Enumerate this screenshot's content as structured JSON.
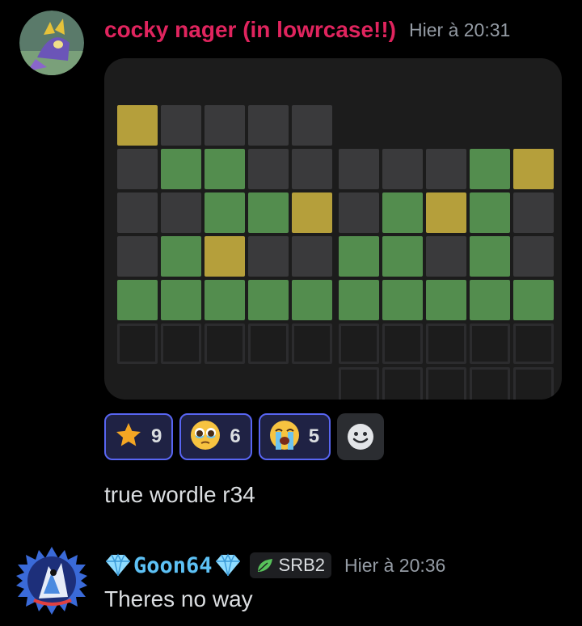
{
  "messages": [
    {
      "username": "cocky nager (in lowrcase!!)",
      "timestamp": "Hier à 20:31",
      "text": "true wordle r34",
      "name_color": "#e0245e",
      "reactions": [
        {
          "emoji": "⭐",
          "icon": "star-icon",
          "count": "9"
        },
        {
          "emoji": "🥹",
          "icon": "holding-back-tears-emoji-icon",
          "count": "6"
        },
        {
          "emoji": "😭",
          "icon": "loudly-crying-emoji-icon",
          "count": "5"
        }
      ]
    },
    {
      "username": "Goon64",
      "timestamp": "Hier à 20:36",
      "text": "Theres no way",
      "tag": "SRB2",
      "name_color": "#5dc1f5"
    }
  ],
  "colors": {
    "green": "#538d4e",
    "yellow": "#b59f3b",
    "gray": "#3a3a3c",
    "reaction_border": "#5865f2"
  }
}
